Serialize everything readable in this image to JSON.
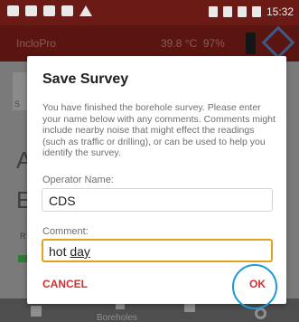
{
  "status_bar": {
    "time": "15:32"
  },
  "app_bar": {
    "title": "IncloPro",
    "temperature": "39.8 °C",
    "battery": "97%"
  },
  "background": {
    "line0": "S",
    "line1": "A",
    "line2": "E",
    "line3": "R"
  },
  "nav": {
    "boreholes_label": "Boreholes"
  },
  "dialog": {
    "title": "Save Survey",
    "message": "You have finished the borehole survey. Please enter your name below with any comments. Comments might include nearby noise that might effect the readings (such as traffic or drilling), or can be used to help you identify the survey.",
    "operator_label": "Operator Name:",
    "operator_value": "CDS",
    "comment_label": "Comment:",
    "comment_word1": "hot",
    "comment_word2": "day",
    "cancel_label": "CANCEL",
    "ok_label": "OK"
  },
  "colors": {
    "accent": "#d32f2f",
    "focus": "#e0a21a",
    "highlight_ring": "#1a9ad6"
  }
}
